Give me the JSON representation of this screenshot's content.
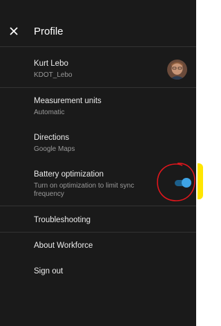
{
  "header": {
    "title": "Profile",
    "close_icon": "close-icon"
  },
  "user": {
    "name": "Kurt Lebo",
    "username": "KDOT_Lebo"
  },
  "settings": {
    "measurement": {
      "label": "Measurement units",
      "value": "Automatic"
    },
    "directions": {
      "label": "Directions",
      "value": "Google Maps"
    },
    "battery": {
      "label": "Battery optimization",
      "description_line1": "Turn on optimization to limit sync",
      "description_line2": "frequency",
      "enabled": true
    }
  },
  "menu": {
    "troubleshooting": "Troubleshooting",
    "about": "About Workforce",
    "sign_out": "Sign out"
  },
  "colors": {
    "background": "#1a1a1a",
    "toggle_accent": "#3ea4e6",
    "annotation": "#e0161c",
    "highlight": "#ffe600"
  }
}
